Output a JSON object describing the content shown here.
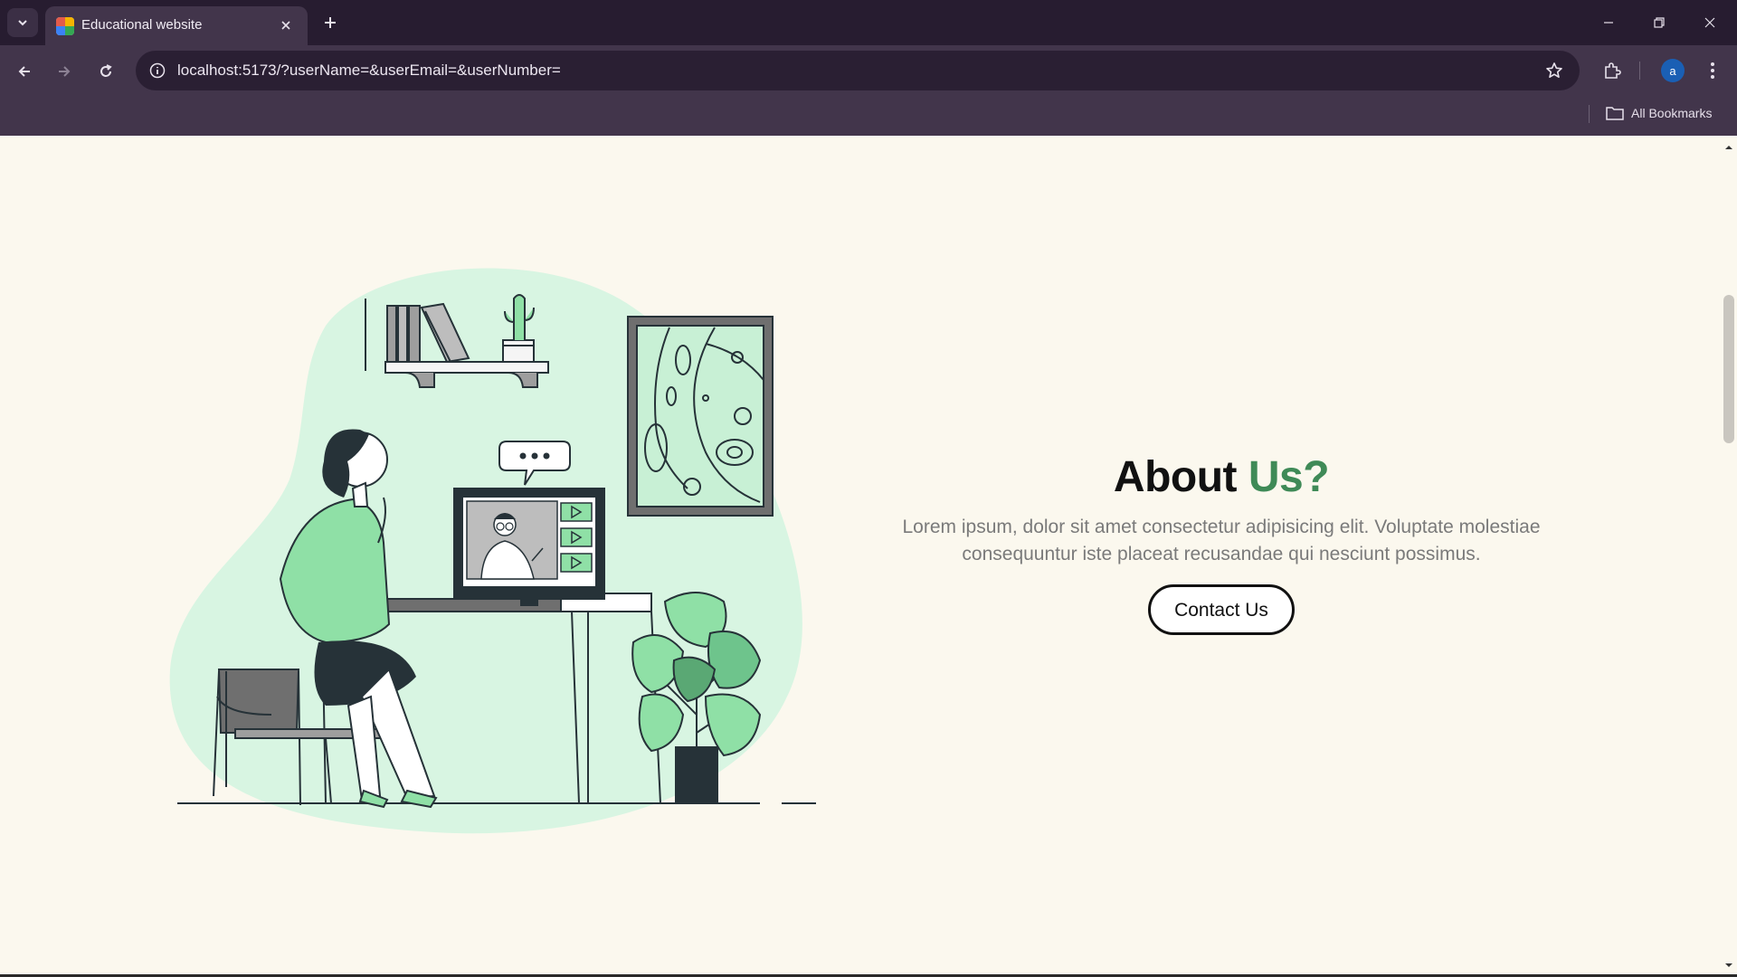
{
  "browser": {
    "tab_title": "Educational website",
    "url": "localhost:5173/?userName=&userEmail=&userNumber=",
    "bookmarks_label": "All Bookmarks",
    "profile_initial": "a",
    "icons": [
      "tab-list-icon",
      "close-icon",
      "plus-icon",
      "minimize-icon",
      "restore-icon",
      "window-close-icon",
      "back-arrow-icon",
      "forward-arrow-icon",
      "reload-icon",
      "info-icon",
      "star-icon",
      "puzzle-icon",
      "kebab-menu-icon",
      "folder-icon"
    ]
  },
  "about": {
    "heading_main": "About",
    "heading_accent": "Us?",
    "description": "Lorem ipsum, dolor sit amet consectetur adipisicing elit. Voluptate molestiae consequuntur iste placeat recusandae qui nesciunt possimus.",
    "button_label": "Contact Us"
  },
  "colors": {
    "page_background": "#fbf8ee",
    "accent_green": "#3f8a57",
    "illustration_green": "#8fe0a6",
    "blob_green": "#d8f5e2",
    "chrome_dark": "#271c30",
    "chrome_toolbar": "#42354b"
  }
}
